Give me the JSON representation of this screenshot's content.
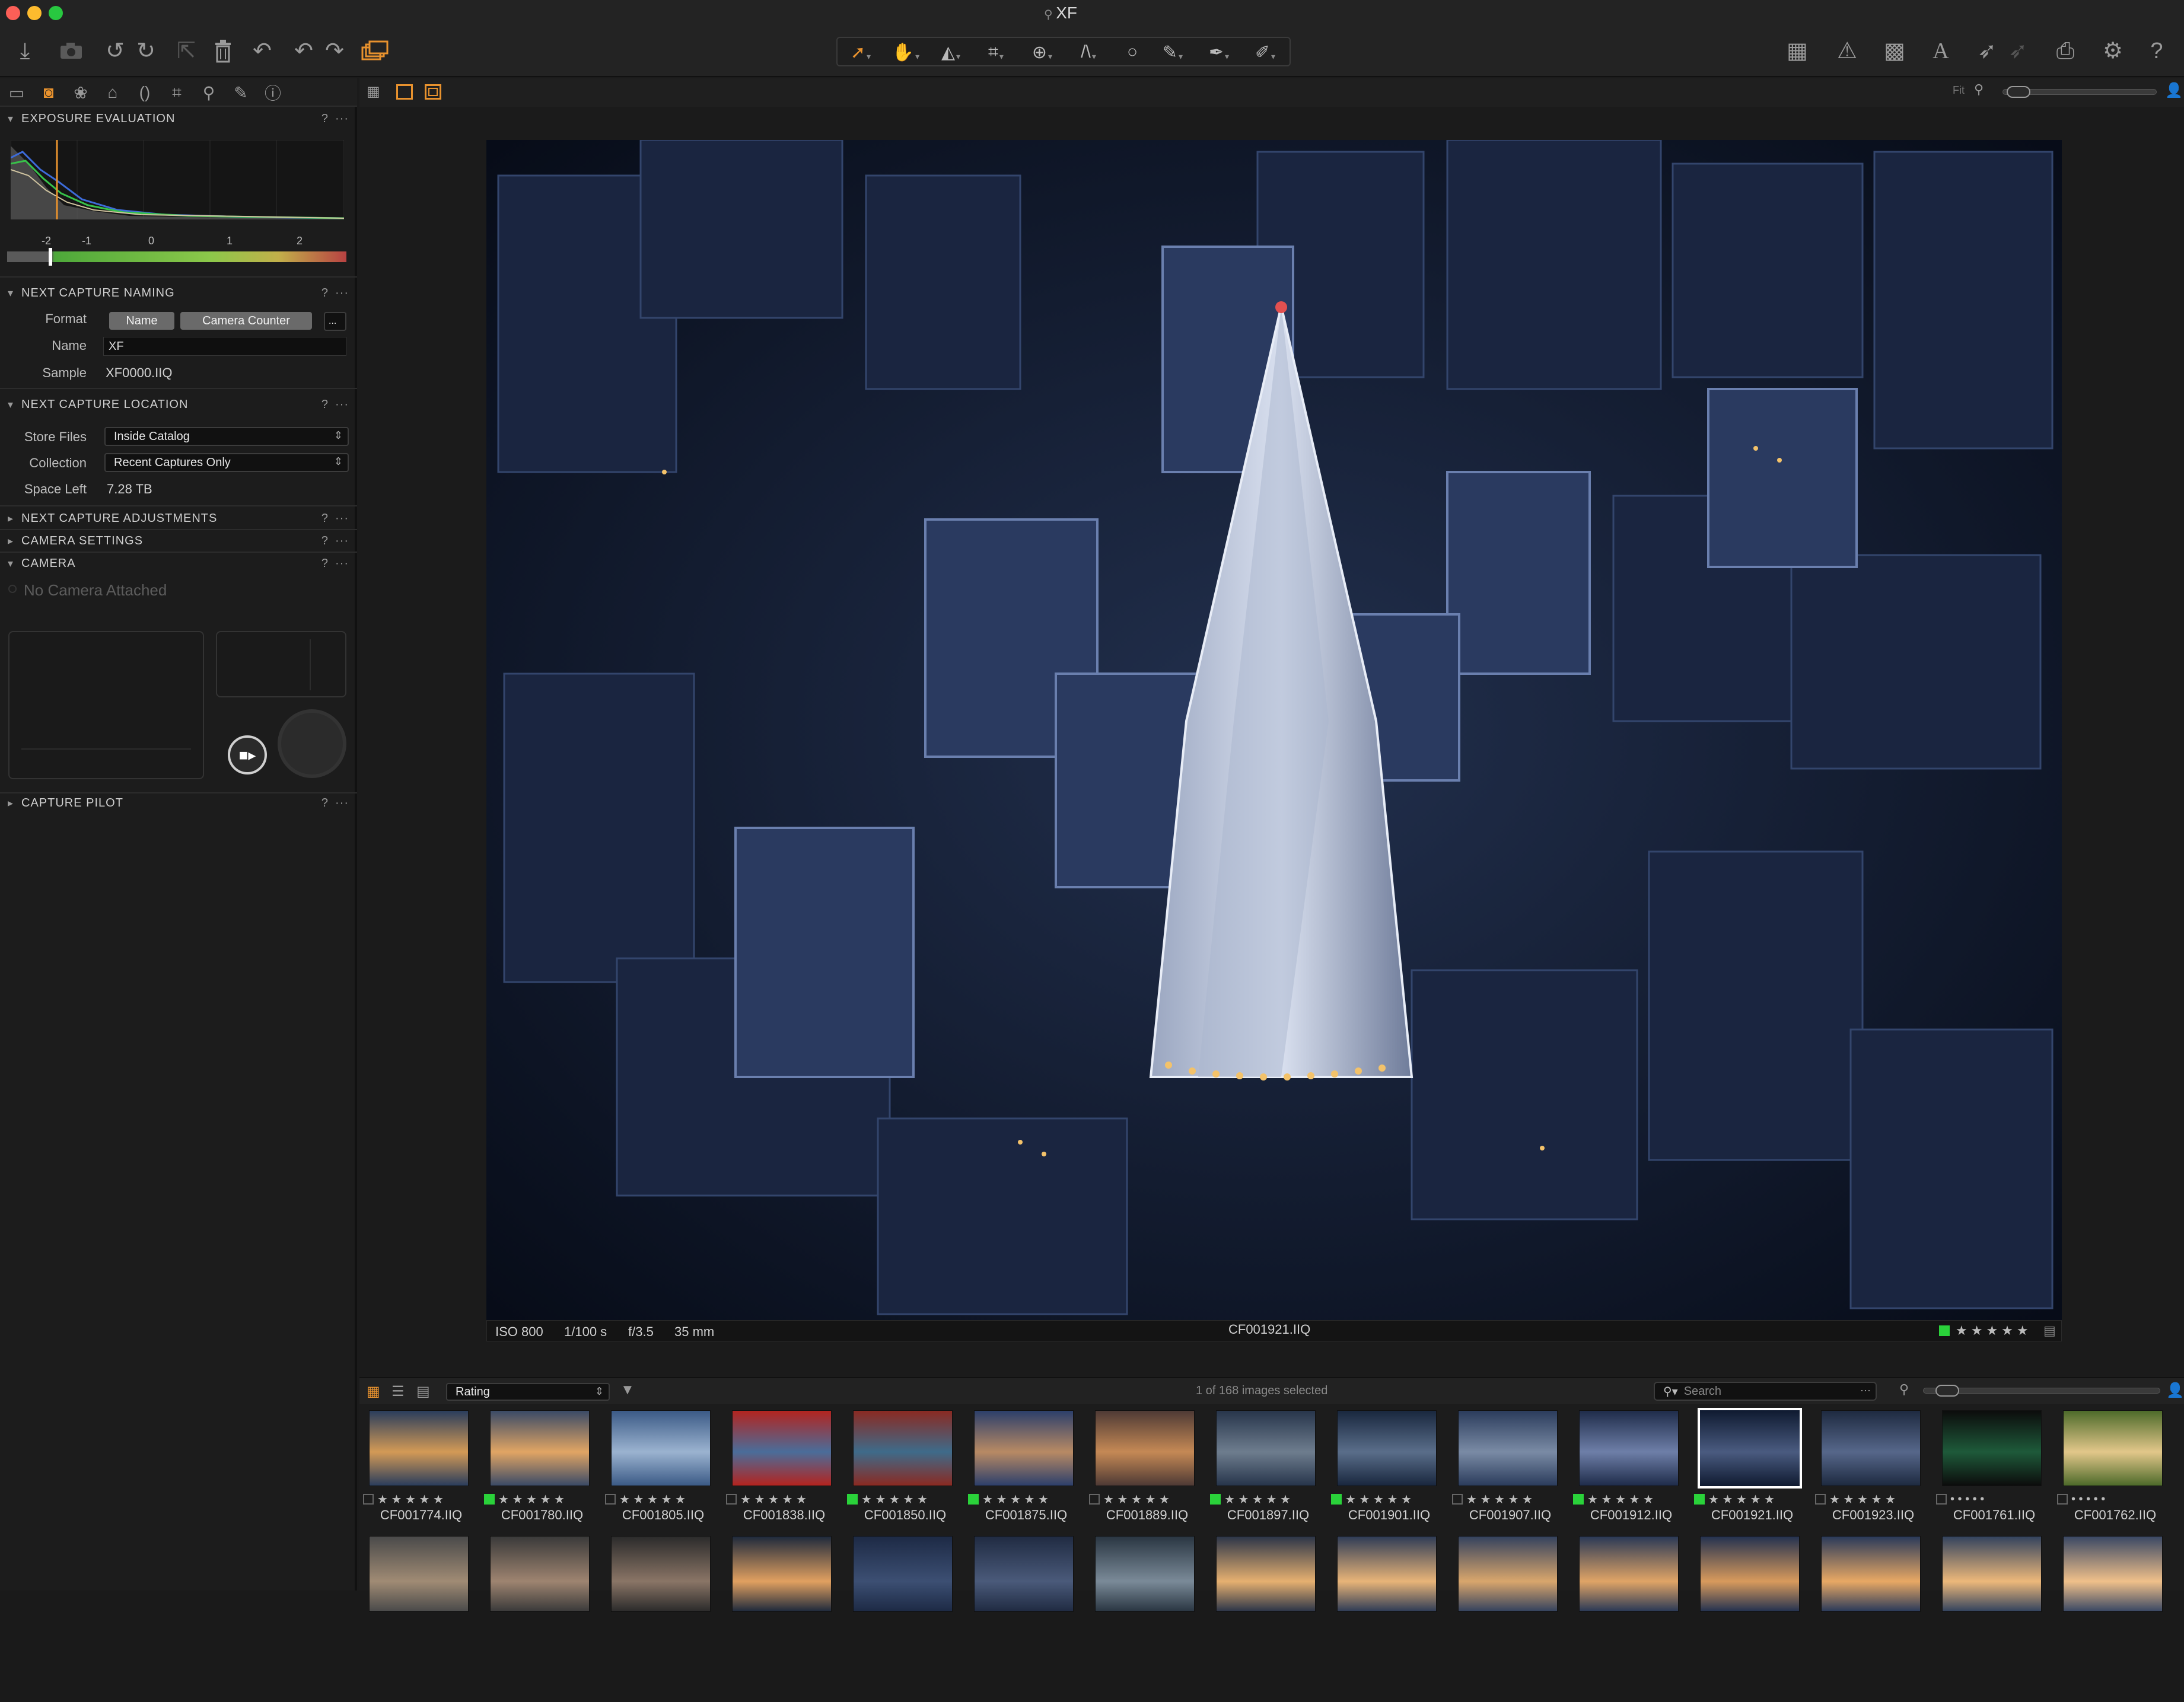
{
  "window": {
    "title": "XF"
  },
  "toolbar": {
    "left_icons": [
      "import-icon",
      "camera-icon",
      "rotate-left-icon",
      "rotate-right-icon",
      "export-icon",
      "trash-icon",
      "undo-icon",
      "undo-alt-icon",
      "redo-icon",
      "stack-icon"
    ],
    "tools": [
      "cursor-tool",
      "pan-tool",
      "levels-tool",
      "crop-tool",
      "rotate-tool",
      "keystone-tool",
      "spot-tool",
      "brush-tool",
      "picker-tool",
      "erase-tool"
    ],
    "right_icons": [
      "grid-icon",
      "warning-icon",
      "focus-mask-icon",
      "text-icon",
      "pick-icon",
      "apply-icon",
      "print-icon",
      "settings-icon",
      "help-icon"
    ]
  },
  "tabs": [
    "library-tab",
    "capture-tab",
    "color-tab",
    "exposure-tab",
    "lens-tab",
    "composition-tab",
    "details-tab",
    "local-adjustments-tab",
    "metadata-tab"
  ],
  "panel": {
    "exposure": {
      "title": "EXPOSURE EVALUATION",
      "ticks": [
        "-2",
        "-1",
        "0",
        "1",
        "2"
      ]
    },
    "naming": {
      "title": "NEXT CAPTURE NAMING",
      "format_label": "Format",
      "format_tokens": [
        "Name",
        "Camera Counter"
      ],
      "format_more": "...",
      "name_label": "Name",
      "name_value": "XF",
      "sample_label": "Sample",
      "sample_value": "XF0000.IIQ"
    },
    "location": {
      "title": "NEXT CAPTURE LOCATION",
      "store_label": "Store Files",
      "store_value": "Inside Catalog",
      "collection_label": "Collection",
      "collection_value": "Recent Captures Only",
      "space_label": "Space Left",
      "space_value": "7.28 TB"
    },
    "adjustments": {
      "title": "NEXT CAPTURE ADJUSTMENTS"
    },
    "camera_settings": {
      "title": "CAMERA SETTINGS"
    },
    "camera": {
      "title": "CAMERA",
      "status": "No Camera Attached"
    },
    "pilot": {
      "title": "CAPTURE PILOT"
    },
    "help": "?",
    "more": "···"
  },
  "viewer": {
    "zoom_label": "Fit",
    "iso": "ISO 800",
    "shutter": "1/100 s",
    "aperture": "f/3.5",
    "focal": "35 mm",
    "filename": "CF001921.IIQ",
    "stars": "★★★★★"
  },
  "browser": {
    "sort_value": "Rating",
    "selection": "1 of 168 images selected",
    "search_placeholder": "Search",
    "thumbs": [
      {
        "name": "CF001774.IIQ",
        "tag": false,
        "stars": "★ ★ ★ ★ ★",
        "c1": "#2a3d5c",
        "c2": "#d39a56"
      },
      {
        "name": "CF001780.IIQ",
        "tag": true,
        "stars": "★ ★ ★ ★ ★",
        "c1": "#3a4a66",
        "c2": "#e1a564"
      },
      {
        "name": "CF001805.IIQ",
        "tag": false,
        "stars": "★ ★ ★ ★ ★",
        "c1": "#3b5a86",
        "c2": "#9bb3d0"
      },
      {
        "name": "CF001838.IIQ",
        "tag": false,
        "stars": "★ ★ ★ ★ ★",
        "c1": "#b3241f",
        "c2": "#4a6d9a"
      },
      {
        "name": "CF001850.IIQ",
        "tag": true,
        "stars": "★ ★ ★ ★ ★",
        "c1": "#8a2a22",
        "c2": "#3e6b8a"
      },
      {
        "name": "CF001875.IIQ",
        "tag": true,
        "stars": "★ ★ ★ ★ ★",
        "c1": "#2c3f6b",
        "c2": "#b88a64"
      },
      {
        "name": "CF001889.IIQ",
        "tag": false,
        "stars": "★ ★ ★ ★ ★",
        "c1": "#4e3a35",
        "c2": "#c58955"
      },
      {
        "name": "CF001897.IIQ",
        "tag": true,
        "stars": "★ ★ ★ ★ ★",
        "c1": "#27354b",
        "c2": "#6e7d8e"
      },
      {
        "name": "CF001901.IIQ",
        "tag": true,
        "stars": "★ ★ ★ ★ ★",
        "c1": "#19273e",
        "c2": "#5a6e8a"
      },
      {
        "name": "CF001907.IIQ",
        "tag": false,
        "stars": "★ ★ ★ ★ ★",
        "c1": "#2b3c5c",
        "c2": "#7a8ba5"
      },
      {
        "name": "CF001912.IIQ",
        "tag": true,
        "stars": "★ ★ ★ ★ ★",
        "c1": "#1f2c4a",
        "c2": "#6e7fa8"
      },
      {
        "name": "CF001921.IIQ",
        "tag": true,
        "stars": "★ ★ ★ ★ ★",
        "c1": "#0f1a30",
        "c2": "#4a5b80",
        "selected": true
      },
      {
        "name": "CF001923.IIQ",
        "tag": false,
        "stars": "★ ★ ★ ★ ★",
        "c1": "#1e2a40",
        "c2": "#56678a"
      },
      {
        "name": "CF001761.IIQ",
        "tag": false,
        "stars": "• • • • •",
        "c1": "#0c0c0c",
        "c2": "#1e5a3a"
      },
      {
        "name": "CF001762.IIQ",
        "tag": false,
        "stars": "• • • • •",
        "c1": "#4d6a2a",
        "c2": "#e2c78a"
      }
    ],
    "row2": [
      {
        "c1": "#4a4a4a",
        "c2": "#a08b74"
      },
      {
        "c1": "#3a3a3a",
        "c2": "#9e8470"
      },
      {
        "c1": "#2b2b2b",
        "c2": "#8a7566"
      },
      {
        "c1": "#1f2a3c",
        "c2": "#e1a060"
      },
      {
        "c1": "#1d2a45",
        "c2": "#3c4f73"
      },
      {
        "c1": "#202b42",
        "c2": "#4a5a7a"
      },
      {
        "c1": "#2a3642",
        "c2": "#7a8a98"
      },
      {
        "c1": "#2c3548",
        "c2": "#e6b070"
      },
      {
        "c1": "#2f3c56",
        "c2": "#e8b478"
      },
      {
        "c1": "#34425e",
        "c2": "#d9a66c"
      },
      {
        "c1": "#2a3956",
        "c2": "#e0a466"
      },
      {
        "c1": "#243250",
        "c2": "#d89a5c"
      },
      {
        "c1": "#2a3a5a",
        "c2": "#e8a864"
      },
      {
        "c1": "#33435e",
        "c2": "#edb87a"
      },
      {
        "c1": "#3a4864",
        "c2": "#f0c08a"
      }
    ]
  },
  "colors": {
    "accent": "#e8922e",
    "tag": "#2ad23a"
  }
}
